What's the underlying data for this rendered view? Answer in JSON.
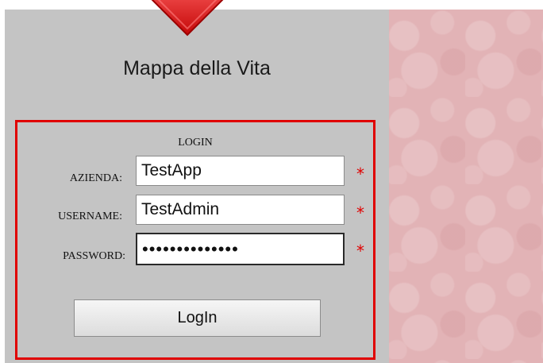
{
  "app": {
    "title": "Mappa della Vita"
  },
  "login": {
    "heading": "LOGIN",
    "fields": [
      {
        "label": "AZIENDA:",
        "value": "TestApp",
        "type": "text",
        "required_mark": "*"
      },
      {
        "label": "USERNAME:",
        "value": "TestAdmin",
        "type": "text",
        "required_mark": "*"
      },
      {
        "label": "PASSWORD:",
        "value": "••••••••••••••",
        "type": "password",
        "required_mark": "*"
      }
    ],
    "submit_label": "LogIn"
  },
  "colors": {
    "panel_bg": "#c4c4c4",
    "border_accent": "#e00000",
    "logo": "#e01010",
    "pattern_bg": "#e2b3b6"
  },
  "icons": {
    "logo": "heart-icon"
  }
}
